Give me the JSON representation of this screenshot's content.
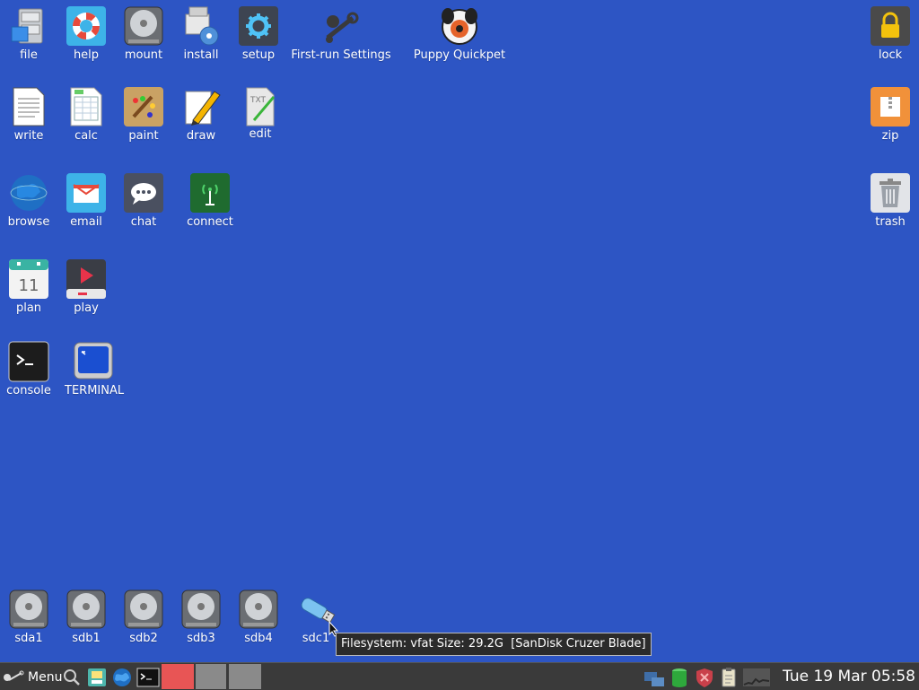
{
  "desktop": {
    "icons": {
      "file": "file",
      "help": "help",
      "mount": "mount",
      "install": "install",
      "setup": "setup",
      "firstrun": "First-run Settings",
      "quickpet": "Puppy Quickpet",
      "write": "write",
      "calc": "calc",
      "paint": "paint",
      "draw": "draw",
      "edit": "edit",
      "browse": "browse",
      "email": "email",
      "chat": "chat",
      "connect": "connect",
      "plan": "plan",
      "play": "play",
      "console": "console",
      "terminal": "TERMINAL",
      "lock": "lock",
      "zip": "zip",
      "trash": "trash"
    },
    "plan_day": "11",
    "txt_badge": "TXT",
    "drives": [
      "sda1",
      "sdb1",
      "sdb2",
      "sdb3",
      "sdb4",
      "sdc1"
    ]
  },
  "tooltip": "Filesystem: vfat Size: 29.2G  [SanDisk Cruzer Blade]",
  "taskbar": {
    "menu_label": "Menu",
    "clock": "Tue 19 Mar 05:58"
  },
  "colors": {
    "desktop_bg": "#2d55c4",
    "taskbar_bg": "#3a3a3a",
    "accent_red": "#e85555"
  }
}
